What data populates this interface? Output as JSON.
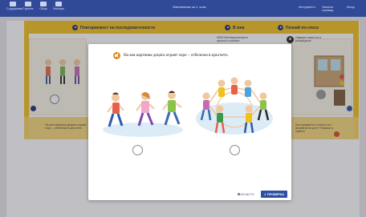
{
  "topbar": {
    "items": [
      {
        "label": "Съдържание",
        "icon": "menu-icon"
      },
      {
        "label": "Търсене",
        "icon": "search-icon"
      },
      {
        "label": "Обща",
        "icon": "book-icon"
      },
      {
        "label": "Бележки",
        "icon": "note-icon"
      }
    ],
    "title": "Математика за 1. клас",
    "right_items": [
      "Инструменти",
      "Начална страница",
      "Изход"
    ]
  },
  "lesson": {
    "sections": [
      "Повтаряемост на последователности",
      "В миа",
      "Познай по-глоса"
    ],
    "notes": [
      "NEW Математическите прости и скобите",
      "Намери тежестта и разпредели"
    ],
    "bottom_text": "На коя картинка децата играят хоро – отбележи в кръгчето.",
    "bottom_right_text": "Кои предмети в стаята са с формата на кръг? Покажи и оцвети."
  },
  "modal": {
    "question": "На коя картинка децата играят хоро – отбележи в кръгчето.",
    "reset_label": "ИЗЧИСТИ",
    "check_label": "ПРОВЕРКА",
    "close_icon": "close-icon",
    "speaker_icon": "speaker-icon",
    "options": [
      {
        "id": "walking-children",
        "selected": false
      },
      {
        "id": "circle-dance-children",
        "selected": false
      }
    ]
  },
  "colors": {
    "topbar": "#314a98",
    "accent_yellow": "#f2c01b",
    "check_button": "#2f4fa3",
    "speaker": "#e08a1e"
  }
}
